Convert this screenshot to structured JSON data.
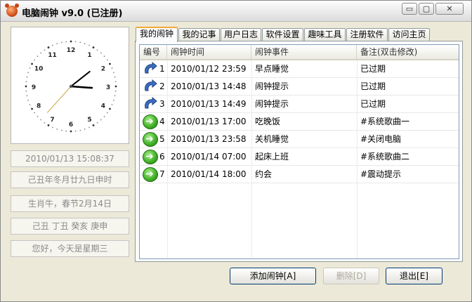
{
  "window": {
    "title": "电脑闹钟  v9.0 (已注册)",
    "minimize_glyph": "▭",
    "maximize_glyph": "▢",
    "close_glyph": "✕"
  },
  "clock": {
    "numerals": [
      "12",
      "1",
      "2",
      "3",
      "4",
      "5",
      "6",
      "7",
      "8",
      "9",
      "10",
      "11"
    ],
    "time": {
      "hour": 15,
      "minute": 8,
      "second": 37
    }
  },
  "info": {
    "datetime": "2010/01/13 15:08:37",
    "lunar_date": "己丑年冬月廿九日申时",
    "zodiac": "生肖牛，春节2月14日",
    "ganzhi": "己丑 丁丑 癸亥 庚申",
    "greeting": "您好，今天是星期三"
  },
  "tabs": [
    "我的闹钟",
    "我的记事",
    "用户日志",
    "软件设置",
    "趣味工具",
    "注册软件",
    "访问主页"
  ],
  "active_tab": 0,
  "table": {
    "columns": [
      "编号",
      "闹钟时间",
      "闹钟事件",
      "备注(双击修改)"
    ],
    "rows": [
      {
        "id": "1",
        "time": "2010/01/12 23:59",
        "event": "早点睡觉",
        "note": "已过期",
        "status": "expired"
      },
      {
        "id": "2",
        "time": "2010/01/13 14:48",
        "event": "闹钟提示",
        "note": "已过期",
        "status": "expired"
      },
      {
        "id": "3",
        "time": "2010/01/13 14:49",
        "event": "闹钟提示",
        "note": "已过期",
        "status": "expired"
      },
      {
        "id": "4",
        "time": "2010/01/13 17:00",
        "event": "吃晚饭",
        "note": "#系统歌曲一",
        "status": "active"
      },
      {
        "id": "5",
        "time": "2010/01/13 23:58",
        "event": "关机睡觉",
        "note": "#关闭电脑",
        "status": "active"
      },
      {
        "id": "6",
        "time": "2010/01/14 07:00",
        "event": "起床上班",
        "note": "#系统歌曲二",
        "status": "active"
      },
      {
        "id": "7",
        "time": "2010/01/14 18:00",
        "event": "约会",
        "note": "#震动提示",
        "status": "active"
      }
    ]
  },
  "buttons": {
    "add": "添加闹钟[A]",
    "delete": "删除[D]",
    "exit": "退出[E]"
  },
  "colors": {
    "expired_icon": "#3a6fc4",
    "active_icon": "#3fae25",
    "tab_highlight": "#f5a934"
  }
}
